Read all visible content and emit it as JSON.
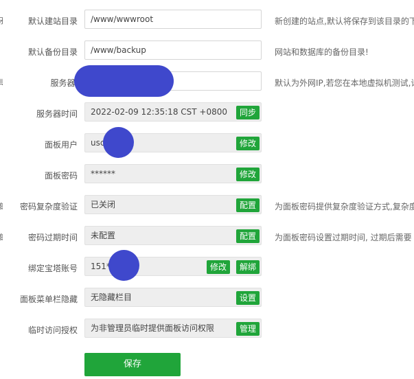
{
  "rows": [
    {
      "label": "默认建站目录",
      "value": "/www/wwwroot",
      "hint": "新创建的站点,默认将保存到该目录的下"
    },
    {
      "label": "默认备份目录",
      "value": "/www/backup",
      "hint": "网站和数据库的备份目录!"
    },
    {
      "label": "服务器I",
      "value": "",
      "hint": "默认为外网IP,若您在本地虚拟机测试,请"
    },
    {
      "label": "服务器时间",
      "value": "2022-02-09 12:35:18 CST +0800",
      "button": "同步"
    },
    {
      "label": "面板用户",
      "value": "usc",
      "button": "修改"
    },
    {
      "label": "面板密码",
      "value": "******",
      "button": "修改"
    },
    {
      "label": "密码复杂度验证",
      "value": "已关闭",
      "button": "配置",
      "hint": "为面板密码提供复杂度验证方式,复杂度"
    },
    {
      "label": "密码过期时间",
      "value": "未配置",
      "button": "配置",
      "hint": "为面板密码设置过期时间, 过期后需要"
    },
    {
      "label": "绑定宝塔账号",
      "value": "151*",
      "button": "修改",
      "button2": "解绑"
    },
    {
      "label": "面板菜单栏隐藏",
      "value": "无隐藏栏目",
      "button": "设置"
    },
    {
      "label": "临时访问授权",
      "value": "为非管理员临时提供面板访问权限",
      "button": "管理"
    }
  ],
  "edge_glyphs": {
    "r0": "牙",
    "r2": "具",
    "r6": "度",
    "r7": "度"
  },
  "save_label": "保存",
  "colors": {
    "accent": "#20a53a",
    "redaction": "#3f48cc"
  }
}
